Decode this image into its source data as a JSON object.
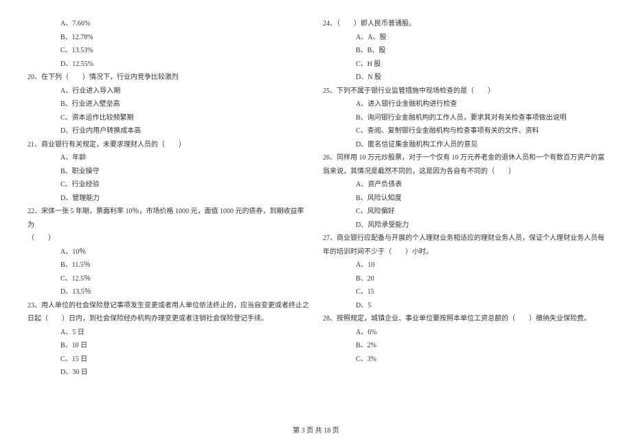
{
  "left": {
    "opt_19a": "A、7.66%",
    "opt_19b": "B、12.78%",
    "opt_19c": "C、13.53%",
    "opt_19d": "D、12.55%",
    "q20": "20、在下列（　　）情况下，行业内竞争比较激烈",
    "opt_20a": "A、行业进入导入期",
    "opt_20b": "B、行业进入壁垒高",
    "opt_20c": "C、资本运作比较频繁期",
    "opt_20d": "D、行业内用户转换成本高",
    "q21": "21、商业银行有关规定，未要求理财人员的（　　）",
    "opt_21a": "A、年龄",
    "opt_21b": "B、职业操守",
    "opt_21c": "C、行业经验",
    "opt_21d": "D、管理能力",
    "q22_a": "22、宋体一张 5 年期，票面利率 10％，市场价格 1000 元，面值 1000 元的债券，到期收益率为",
    "q22_b": "（　　）",
    "opt_22a": "A、10％",
    "opt_22b": "B、11.5％",
    "opt_22c": "C、12.5％",
    "opt_22d": "D、13.5％",
    "q23_a": "23、用人单位的社会保险登记事项发生变更或者用人单位依法终止的，应当自变更或者终止之",
    "q23_b": "日起（　　）日内，到社会保险经办机构办理变更或者注销社会保险登记手续。",
    "opt_23a": "A、5 日",
    "opt_23b": "B、10 日",
    "opt_23c": "C、15 日",
    "opt_23d": "D、30 日"
  },
  "right": {
    "q24": "24、（　　）即人民币普通股。",
    "opt_24a": "A、A、股",
    "opt_24b": "B、B、股",
    "opt_24c": "C、H 股",
    "opt_24d": "D、N 股",
    "q25": "25、下列不属于银行业监管措施中现场检查的是（　　）",
    "opt_25a": "A、进入银行业金融机构进行检查",
    "opt_25b": "B、询问银行业金融机构的工作人员，要求其对有关检查事项做出说明",
    "opt_25c": "C、查阅、复制银行业金融机构与检查事项有关的文件、资料",
    "opt_25d": "D、匿名信征集金融机构工作人员的意见",
    "q26_a": "26、同样用 10 万元炒股票，对于一个仅有 10 万元养老金的退休人员和一个有数百万资产的富",
    "q26_b": "翁来说，其情况是截然不同的，这是因为各自有不同的（　　）",
    "opt_26a": "A、资产负债表",
    "opt_26b": "B、风险认知度",
    "opt_26c": "C、风险偏好",
    "opt_26d": "D、风险承受能力",
    "q27_a": "27、商业银行应配备与开展的个人理财业务相适应的理财业务人员，保证个人理财业务人员每",
    "q27_b": "年的培训时间不少于（　　）小时。",
    "opt_27a": "A、10",
    "opt_27b": "B、20",
    "opt_27c": "C、15",
    "opt_27d": "D、5",
    "q28": "28、按照规定，城镇企业、事业单位要按照本单位工资总额的（　　）缴纳失业保险费。",
    "opt_28a": "A、6%",
    "opt_28b": "B、2%",
    "opt_28c": "C、3%"
  },
  "footer": "第 3 页 共 18 页"
}
